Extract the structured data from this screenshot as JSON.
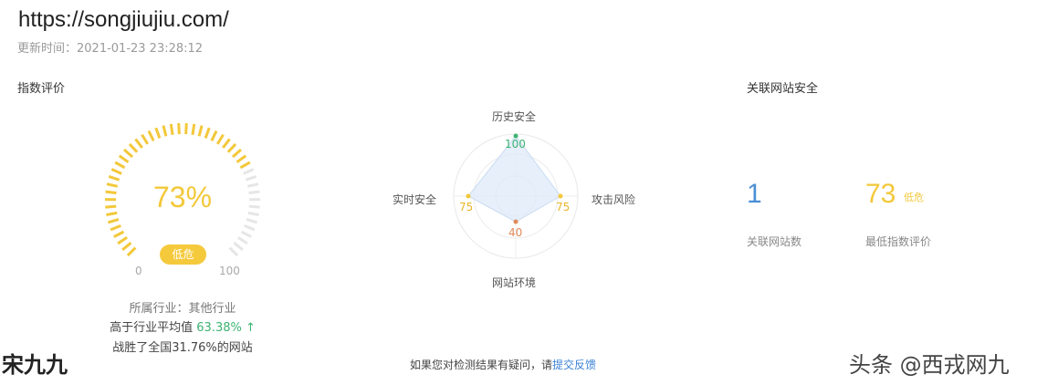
{
  "header": {
    "url": "https://songjiujiu.com/",
    "updated": "更新时间：2021-01-23 23:28:12"
  },
  "index_section": {
    "title": "指数评价",
    "score_pct": "73%",
    "score_value": 73,
    "level_badge": "低危",
    "min_label": "0",
    "max_label": "100",
    "industry": "所属行业：其他行业",
    "above_avg_prefix": "高于行业平均值",
    "above_avg_value": "63.38%",
    "arrow": "↑",
    "beat": "战胜了全国31.76%的网站",
    "colors": {
      "gauge_active": "#f3c83a",
      "gauge_inactive": "#e6e6e6"
    }
  },
  "radar": {
    "axes": [
      {
        "label": "历史安全",
        "value": "100"
      },
      {
        "label": "攻击风险",
        "value": "75"
      },
      {
        "label": "网站环境",
        "value": "40"
      },
      {
        "label": "实时安全",
        "value": "75"
      }
    ],
    "colors": {
      "top": "#3cb371",
      "right": "#f3c83a",
      "bottom": "#e08a5a",
      "left": "#f3c83a",
      "fill": "#dde9f8"
    }
  },
  "related_section": {
    "title": "关联网站安全",
    "count": "1",
    "count_label": "关联网站数",
    "min_score": "73",
    "min_level": "低危",
    "min_label": "最低指数评价"
  },
  "footer": {
    "prefix": "如果您对检测结果有疑问，请",
    "link": "提交反馈"
  },
  "watermarks": {
    "left": "宋九九",
    "right": "头条 @西戎网九"
  }
}
